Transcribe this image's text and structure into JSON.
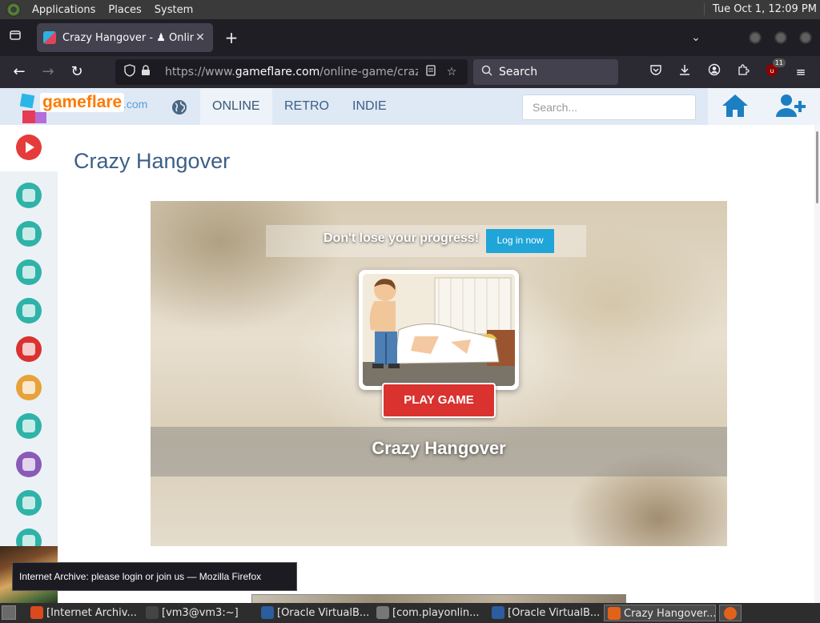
{
  "system_panel": {
    "menus": [
      "Applications",
      "Places",
      "System"
    ],
    "clock": "Tue Oct  1, 12:09 PM"
  },
  "browser": {
    "tab_title": "Crazy Hangover - ♟ Online",
    "url_prefix": "https://www.",
    "url_domain": "gameflare.com",
    "url_path": "/online-game/crazy-h",
    "search_placeholder": "Search",
    "extension_badge": "11"
  },
  "site": {
    "logo_word": "gameflare",
    "logo_tld": ".com",
    "nav": [
      "ONLINE",
      "RETRO",
      "INDIE"
    ],
    "active_nav": "ONLINE",
    "search_placeholder": "Search..."
  },
  "sidebar": {
    "icons": [
      {
        "name": "category-3d-icon",
        "color": "#2fb3a8"
      },
      {
        "name": "category-penguin-icon",
        "color": "#2fb3a8"
      },
      {
        "name": "category-car-icon",
        "color": "#2fb3a8"
      },
      {
        "name": "category-gamepad-icon",
        "color": "#2fb3a8"
      },
      {
        "name": "category-clown-icon",
        "color": "#d9322f"
      },
      {
        "name": "category-monkey-icon",
        "color": "#e8a23a"
      },
      {
        "name": "category-multiplayer-icon",
        "color": "#2fb3a8"
      },
      {
        "name": "category-fantasy-icon",
        "color": "#8a5ab8"
      },
      {
        "name": "category-puzzle-icon",
        "color": "#2fb3a8"
      },
      {
        "name": "category-more-icon",
        "color": "#2fb3a8"
      }
    ]
  },
  "main": {
    "page_title": "Crazy Hangover",
    "progress_text": "Don't lose your progress!",
    "login_button": "Log in now",
    "play_button": "PLAY GAME",
    "game_caption": "Crazy Hangover"
  },
  "tooltip": "Internet Archive: please login or join us — Mozilla Firefox",
  "taskbar": {
    "tasks": [
      {
        "label": "[Internet Archiv...",
        "icon_color": "#d94a1e"
      },
      {
        "label": "[vm3@vm3:~]",
        "icon_color": "#444444"
      },
      {
        "label": "[Oracle VirtualB...",
        "icon_color": "#2c5d9e"
      },
      {
        "label": "[com.playonlin...",
        "icon_color": "#777777"
      },
      {
        "label": "[Oracle VirtualB...",
        "icon_color": "#2c5d9e"
      },
      {
        "label": "Crazy Hangover...",
        "icon_color": "#e2621c"
      }
    ]
  },
  "colors": {
    "brand_blue": "#3c5f86",
    "play_red": "#d9322f",
    "login_blue": "#1fa5d8",
    "logo_orange": "#ff7a00"
  }
}
